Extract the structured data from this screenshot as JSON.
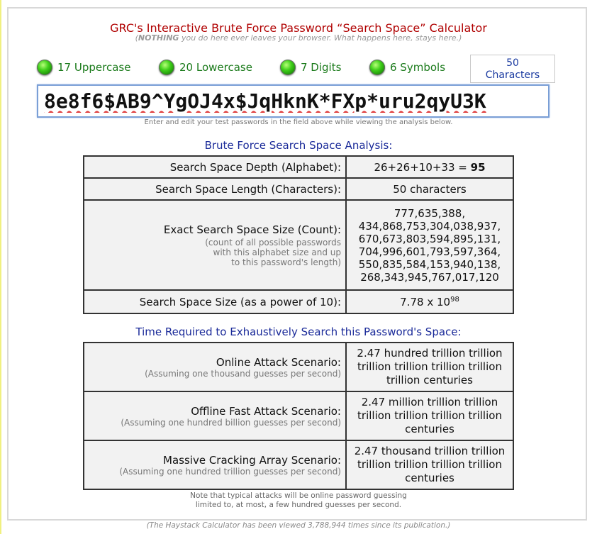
{
  "header": {
    "title": "GRC's Interactive Brute Force Password “Search Space” Calculator",
    "subtitle_bold": "NOTHING",
    "subtitle_rest": " you do here ever leaves your browser. What happens here, stays here.)",
    "subtitle_open": "("
  },
  "counters": [
    {
      "label": "17 Uppercase",
      "icon": "green-led-icon"
    },
    {
      "label": "20 Lowercase",
      "icon": "green-led-icon"
    },
    {
      "label": "7 Digits",
      "icon": "green-led-icon"
    },
    {
      "label": "6 Symbols",
      "icon": "green-led-icon"
    }
  ],
  "length_box": {
    "count": "50",
    "unit": "Characters"
  },
  "password": {
    "value": "8e8f6$AB9^YgOJ4x$JqHknK*FXp*uru2qyU3K"
  },
  "hint": "Enter and edit your test passwords in the field above while viewing the analysis below.",
  "analysis": {
    "title": "Brute Force Search Space Analysis:",
    "depth_label": "Search Space Depth (Alphabet):",
    "depth_value_prefix": "26+26+10+33 = ",
    "depth_value_total": "95",
    "length_label": "Search Space Length (Characters):",
    "length_value": "50 characters",
    "exact_label": "Exact Search Space Size (Count):",
    "exact_note_1": "(count of all possible passwords",
    "exact_note_2": "with this alphabet size and up",
    "exact_note_3": "to this password's length)",
    "exact_lines": [
      "777,635,388,",
      "434,868,753,304,038,937,",
      "670,673,803,594,895,131,",
      "704,996,601,793,597,364,",
      "550,835,584,153,940,138,",
      "268,343,945,767,017,120"
    ],
    "power_label": "Search Space Size (as a power of 10):",
    "power_mantissa": "7.78 x 10",
    "power_exponent": "98"
  },
  "time": {
    "title": "Time Required to Exhaustively Search this Password's Space:",
    "rows": [
      {
        "label": "Online Attack Scenario:",
        "note": "(Assuming one thousand guesses per second)",
        "value": "2.47 hundred trillion trillion trillion trillion trillion trillion trillion centuries"
      },
      {
        "label": "Offline Fast Attack Scenario:",
        "note": "(Assuming one hundred billion guesses per second)",
        "value": "2.47 million trillion trillion trillion trillion trillion trillion centuries"
      },
      {
        "label": "Massive Cracking Array Scenario:",
        "note": "(Assuming one hundred trillion guesses per second)",
        "value": "2.47 thousand trillion trillion trillion trillion trillion trillion centuries"
      }
    ]
  },
  "footer": {
    "note_1": "Note that typical attacks will be online password guessing",
    "note_2": "limited to, at most, a few hundred guesses per second.",
    "views": "(The Haystack Calculator has been viewed 3,788,944 times since its publication.)"
  }
}
